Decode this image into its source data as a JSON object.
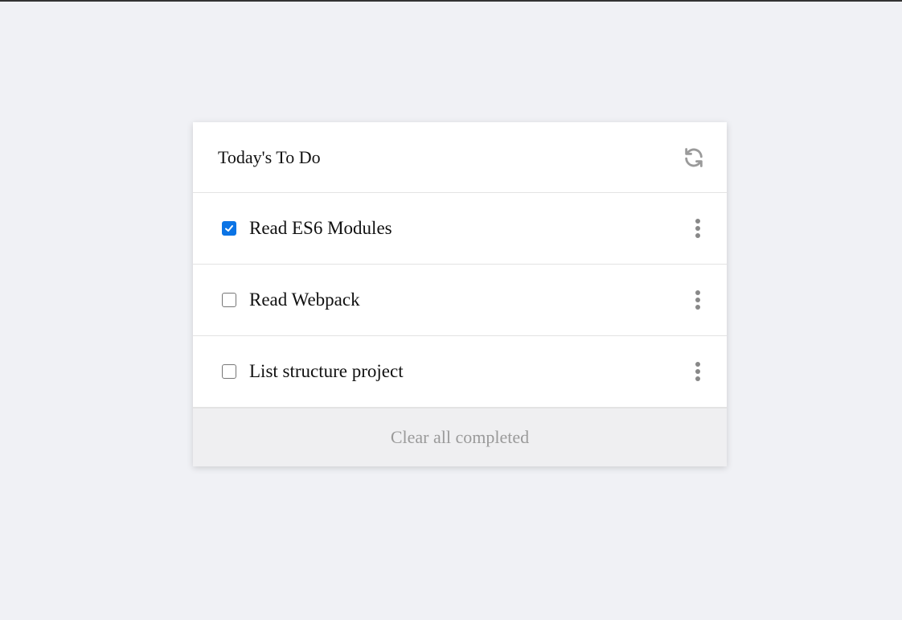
{
  "header": {
    "title": "Today's To Do",
    "refresh_icon": "refresh-icon"
  },
  "items": [
    {
      "label": "Read ES6 Modules",
      "checked": true
    },
    {
      "label": "Read Webpack",
      "checked": false
    },
    {
      "label": "List structure project",
      "checked": false
    }
  ],
  "footer": {
    "clear_label": "Clear all completed"
  },
  "colors": {
    "background": "#f0f1f5",
    "checkbox_checked": "#0b74e5",
    "muted_text": "#9a9a9a"
  }
}
